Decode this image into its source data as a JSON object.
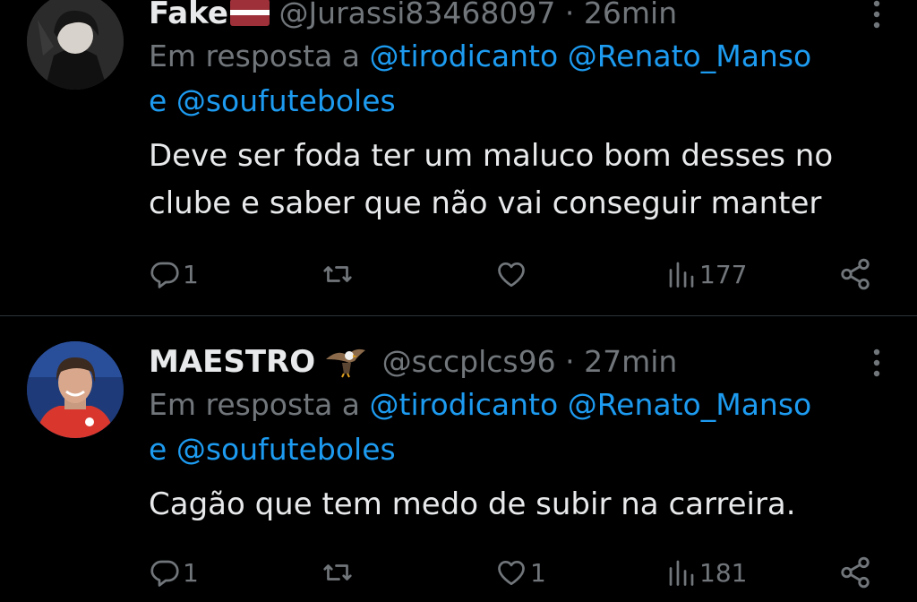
{
  "tweets": [
    {
      "display_name": "Fake",
      "handle": "@Jurassi83468097",
      "separator": "·",
      "time": "26min",
      "reply_prefix": "Em resposta a",
      "mentions": [
        "@tirodicanto",
        "@Renato_Manso",
        "@soufuteboles"
      ],
      "reply_joiner": "e",
      "text": "Deve ser foda ter um maluco bom desses no clube e saber que não vai conseguir manter",
      "replies": "1",
      "retweets": "",
      "likes": "",
      "views": "177",
      "flag": "latvia-flag-icon"
    },
    {
      "display_name": "MAESTRO",
      "handle": "@sccplcs96",
      "separator": "·",
      "time": "27min",
      "reply_prefix": "Em resposta a",
      "mentions": [
        "@tirodicanto",
        "@Renato_Manso",
        "@soufuteboles"
      ],
      "reply_joiner": "e",
      "text": "Cagão que tem medo de subir na carreira.",
      "replies": "1",
      "retweets": "",
      "likes": "1",
      "views": "181",
      "emoji": "eagle-icon"
    }
  ],
  "colors": {
    "background": "#000000",
    "text": "#e7e9ea",
    "muted": "#71767b",
    "link": "#1d9bf0",
    "divider": "#2f3336"
  }
}
